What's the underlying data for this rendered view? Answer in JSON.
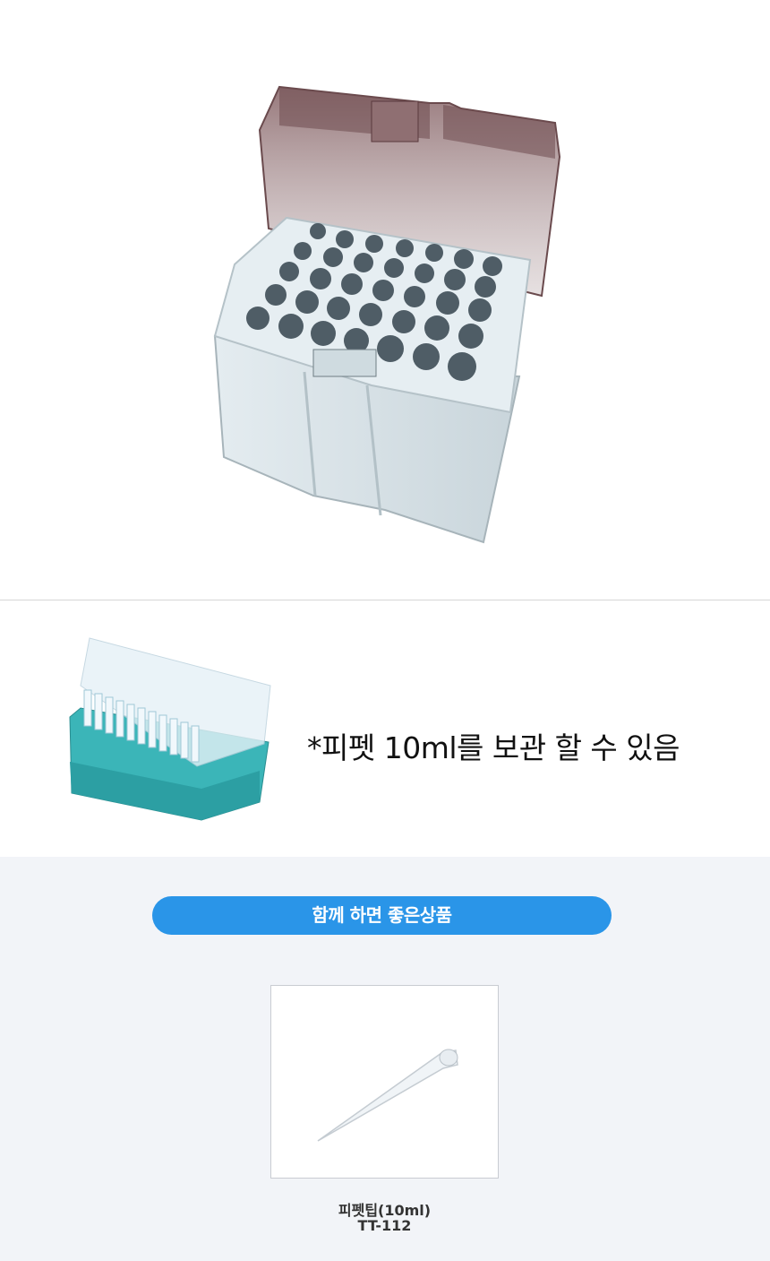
{
  "hero": {
    "image": "pipette-tip-box-with-open-smoke-lid-icon"
  },
  "feature": {
    "image": "blue-pipette-tip-rack-icon",
    "text": "*피펫 10ml를 보관 할 수 있음"
  },
  "related": {
    "heading": "함께 하면 좋은상품",
    "products": [
      {
        "name": "피펫팁(10ml)",
        "code": "TT-112",
        "image": "pipette-tip-icon"
      }
    ]
  },
  "colors": {
    "pill": "#2a95e8",
    "related_bg": "#f2f4f8",
    "box_body": "#d9e3e8",
    "lid": "#9a7c7e"
  }
}
